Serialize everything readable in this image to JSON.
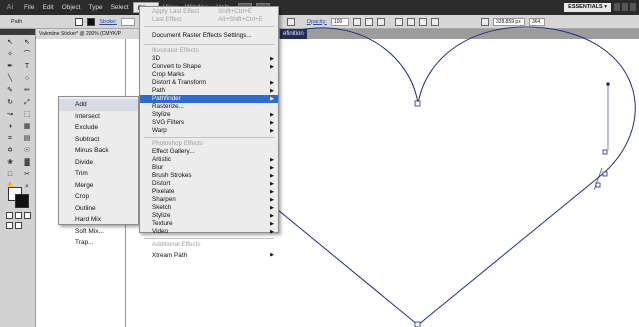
{
  "app": {
    "logo": "Ai"
  },
  "menubar": {
    "items": [
      "File",
      "Edit",
      "Object",
      "Type",
      "Select",
      "Effect",
      "View",
      "Window",
      "Help"
    ],
    "workspace": "ESSENTIALS ▾"
  },
  "controlbar": {
    "selection": "Path",
    "stroke_label": "Stroke:",
    "opacity_label": "Opacity:",
    "opacity_value": "100",
    "coordinate_value": "328.859 px",
    "w_value": "364"
  },
  "document": {
    "tab_title": "Valentine Sticker* @ 200% (CMYK/P",
    "tab_close": "×",
    "partial_tab": "efinition"
  },
  "effect_menu": {
    "apply_last": "Apply Last Effect",
    "apply_last_shortcut": "Shift+Ctrl+E",
    "last_effect": "Last Effect",
    "last_effect_shortcut": "Alt+Shift+Ctrl+E",
    "document_raster": "Document Raster Effects Settings...",
    "illustrator_heading": "Illustrator Effects",
    "illustrator_items": [
      "3D",
      "Convert to Shape",
      "Crop Marks",
      "Distort & Transform",
      "Path",
      "Pathfinder",
      "Rasterize...",
      "Stylize",
      "SVG Filters",
      "Warp"
    ],
    "photoshop_heading": "Photoshop Effects",
    "photoshop_items": [
      "Effect Gallery...",
      "Artistic",
      "Blur",
      "Brush Strokes",
      "Distort",
      "Pixelate",
      "Sharpen",
      "Sketch",
      "Stylize",
      "Texture",
      "Video"
    ],
    "additional_heading": "Additional Effects",
    "additional_items": [
      "Xtream Path"
    ]
  },
  "pathfinder_submenu": {
    "items": [
      "Add",
      "Intersect",
      "Exclude",
      "Subtract",
      "Minus Back",
      "Divide",
      "Trim",
      "Merge",
      "Crop",
      "Outline",
      "Hard Mix",
      "Soft Mix...",
      "Trap..."
    ]
  },
  "colors": {
    "menubar_bg": "#2b2b2b",
    "menu_highlight": "#2d6bd3",
    "path_stroke": "#1f2f7a"
  }
}
